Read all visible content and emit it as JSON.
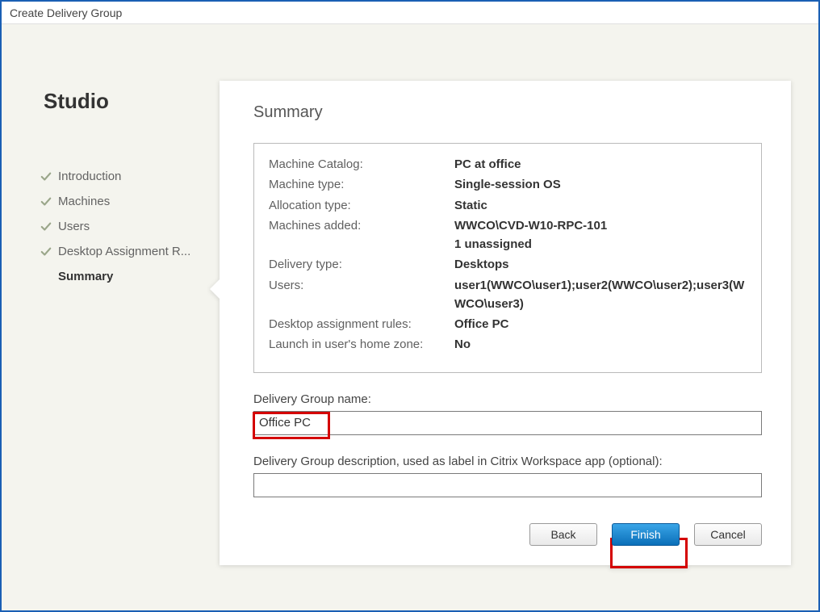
{
  "window": {
    "title": "Create Delivery Group"
  },
  "sidebar": {
    "app_title": "Studio",
    "items": [
      {
        "label": "Introduction",
        "done": true,
        "current": false
      },
      {
        "label": "Machines",
        "done": true,
        "current": false
      },
      {
        "label": "Users",
        "done": true,
        "current": false
      },
      {
        "label": "Desktop Assignment R...",
        "done": true,
        "current": false
      },
      {
        "label": "Summary",
        "done": false,
        "current": true
      }
    ]
  },
  "main": {
    "heading": "Summary",
    "rows": [
      {
        "label": "Machine Catalog:",
        "value": "PC at office"
      },
      {
        "label": "Machine type:",
        "value": "Single-session OS"
      },
      {
        "label": "Allocation type:",
        "value": "Static"
      },
      {
        "label": "Machines added:",
        "value_lines": [
          "WWCO\\CVD-W10-RPC-101",
          "1 unassigned"
        ]
      },
      {
        "label": "Delivery type:",
        "value": "Desktops"
      },
      {
        "label": "Users:",
        "value": "user1(WWCO\\user1);user2(WWCO\\user2);user3(WWCO\\user3)"
      },
      {
        "label": "Desktop assignment rules:",
        "value": "Office PC"
      },
      {
        "label": "Launch in user's home zone:",
        "value": "No"
      }
    ],
    "name_label": "Delivery Group name:",
    "name_value": "Office PC",
    "desc_label": "Delivery Group description, used as label in Citrix Workspace app (optional):",
    "desc_value": ""
  },
  "buttons": {
    "back": "Back",
    "finish": "Finish",
    "cancel": "Cancel"
  },
  "colors": {
    "window_border": "#1a5fb4",
    "highlight": "#d40000"
  }
}
